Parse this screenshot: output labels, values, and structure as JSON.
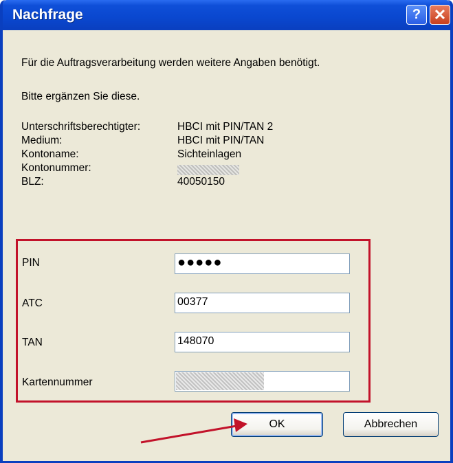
{
  "window": {
    "title": "Nachfrage",
    "help_glyph": "?",
    "close_glyph": "✕"
  },
  "intro": {
    "line1": "Für die Auftragsverarbeitung werden weitere Angaben benötigt.",
    "line2": "Bitte ergänzen Sie diese."
  },
  "info": [
    {
      "label": "Unterschriftsberechtigter:",
      "value": "HBCI mit PIN/TAN 2"
    },
    {
      "label": "Medium:",
      "value": "HBCI mit PIN/TAN"
    },
    {
      "label": "Kontoname:",
      "value": "Sichteinlagen"
    },
    {
      "label": "Kontonummer:",
      "value": ""
    },
    {
      "label": "BLZ:",
      "value": "40050150"
    }
  ],
  "fields": {
    "pin": {
      "label": "PIN",
      "value": "●●●●●"
    },
    "atc": {
      "label": "ATC",
      "value": "00377"
    },
    "tan": {
      "label": "TAN",
      "value": "148070"
    },
    "kartennummer": {
      "label": "Kartennummer",
      "value": ""
    }
  },
  "buttons": {
    "ok": "OK",
    "cancel": "Abbrechen"
  },
  "colors": {
    "highlight_box": "#c2122a",
    "arrow": "#c2122a",
    "titlebar": "#0a48d0"
  }
}
